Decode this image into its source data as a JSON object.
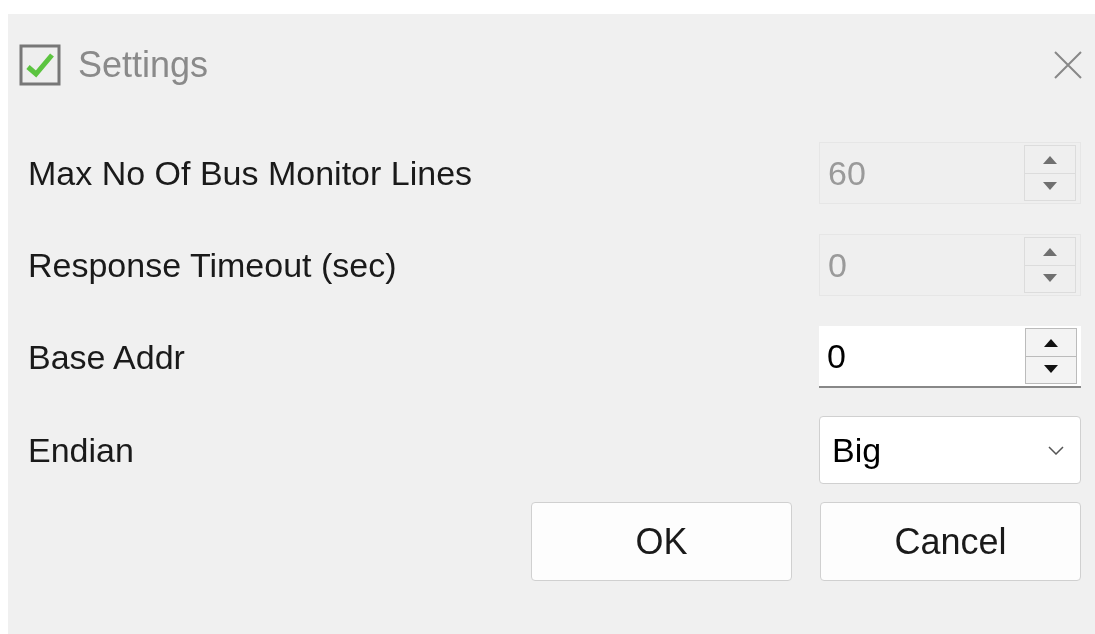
{
  "window": {
    "title": "Settings"
  },
  "fields": [
    {
      "kind": "spin",
      "label": "Max No Of Bus Monitor Lines",
      "value": "60",
      "disabled": true
    },
    {
      "kind": "spin",
      "label": "Response Timeout (sec)",
      "value": "0",
      "disabled": true
    },
    {
      "kind": "spin",
      "label": "Base Addr",
      "value": "0",
      "disabled": false
    },
    {
      "kind": "combo",
      "label": "Endian",
      "value": "Big",
      "disabled": false
    }
  ],
  "buttons": [
    "OK",
    "Cancel"
  ]
}
